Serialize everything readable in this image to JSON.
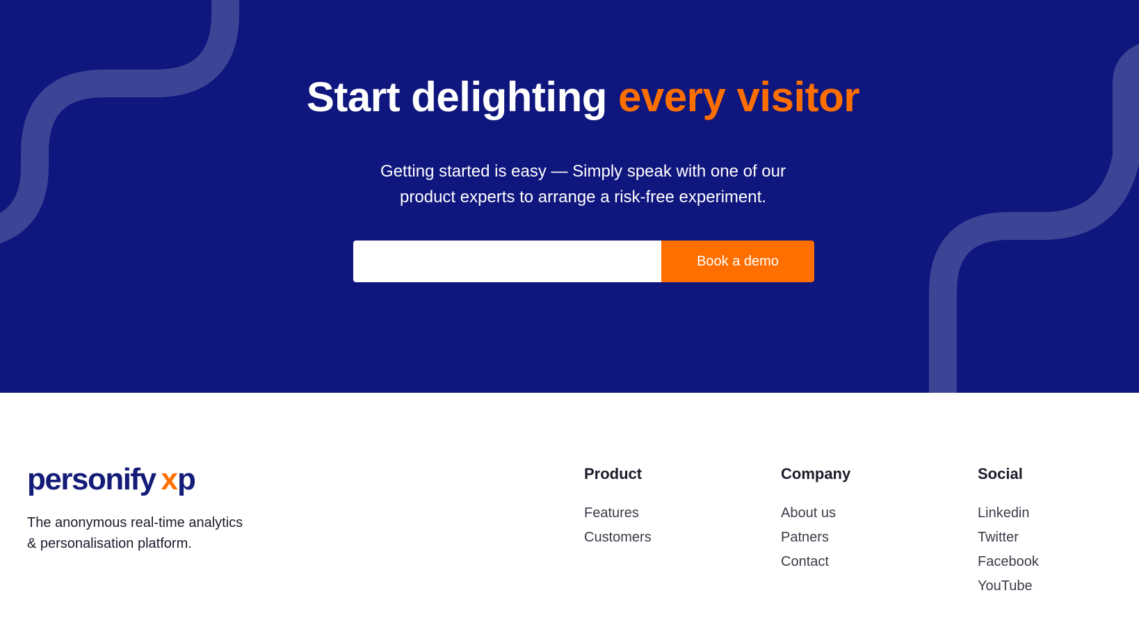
{
  "hero": {
    "headline_main": "Start delighting",
    "headline_accent": "every visitor",
    "subtext_line1": "Getting started is easy — Simply speak with one of our",
    "subtext_line2": "product experts to arrange a risk-free experiment.",
    "email_placeholder": "",
    "cta_label": "Book a demo"
  },
  "footer": {
    "logo_brand": "personify",
    "logo_xp_x": "x",
    "logo_xp_p": "p",
    "tagline_line1": "The anonymous real-time analytics",
    "tagline_line2": "& personalisation platform.",
    "columns": [
      {
        "heading": "Product",
        "links": [
          "Features",
          "Customers"
        ]
      },
      {
        "heading": "Company",
        "links": [
          "About us",
          "Patners",
          "Contact"
        ]
      },
      {
        "heading": "Social",
        "links": [
          "Linkedin",
          "Twitter",
          "Facebook",
          "YouTube"
        ]
      }
    ]
  },
  "colors": {
    "hero_bg": "#0f167d",
    "accent": "#ff6f00",
    "brand_navy": "#141c78",
    "deco_stroke": "#3d4496"
  }
}
